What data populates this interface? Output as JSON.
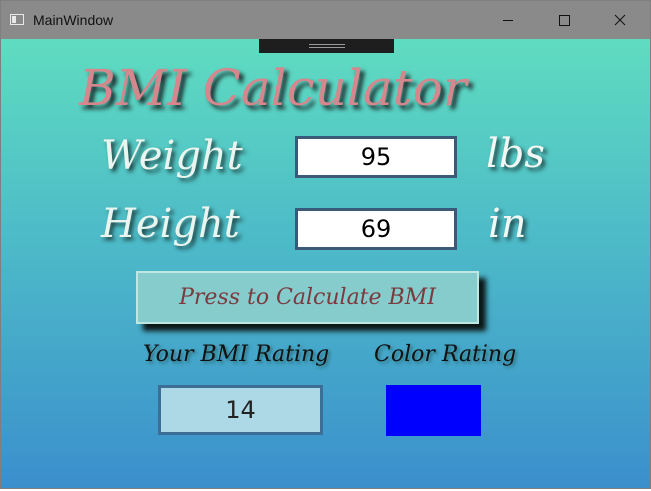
{
  "window": {
    "title": "MainWindow",
    "controls": {
      "minimize": "minimize-icon",
      "maximize": "maximize-icon",
      "close": "close-icon"
    }
  },
  "app": {
    "title": "BMI Calculator",
    "weight": {
      "label": "Weight",
      "value": "95",
      "unit": "lbs"
    },
    "height": {
      "label": "Height",
      "value": "69",
      "unit": "in"
    },
    "calculate_button": "Press to Calculate BMI",
    "bmi_label": "Your BMI Rating",
    "bmi_value": "14",
    "color_label": "Color Rating",
    "color_value": "#0000ff"
  },
  "colors": {
    "gradient_top": "#5fdcc0",
    "gradient_bottom": "#3b8fcc",
    "title_pink": "#d4878c",
    "input_border": "#3b5978",
    "button_fill": "#86cccc",
    "bmi_box": "#add8e6"
  }
}
